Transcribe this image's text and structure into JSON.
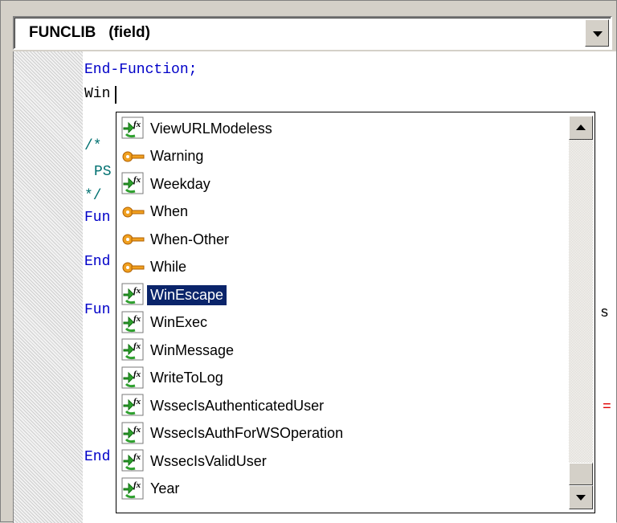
{
  "header": {
    "title": "FUNCLIB   (field)"
  },
  "editor": {
    "lines": {
      "end_function": "End-Function;",
      "typed": "Win",
      "comment_open": "/*",
      "ps": "PS",
      "comment_close": "*/",
      "fun1": "Fun",
      "end1": "End",
      "fun2": "Fun",
      "end2": "End",
      "right_as": "s",
      "right_eq": "="
    }
  },
  "autocomplete": {
    "selected": "WinEscape",
    "items": [
      {
        "label": "ViewURLModeless",
        "icon": "function-icon"
      },
      {
        "label": "Warning",
        "icon": "keyword-icon"
      },
      {
        "label": "Weekday",
        "icon": "function-icon"
      },
      {
        "label": "When",
        "icon": "keyword-icon"
      },
      {
        "label": "When-Other",
        "icon": "keyword-icon"
      },
      {
        "label": "While",
        "icon": "keyword-icon"
      },
      {
        "label": "WinEscape",
        "icon": "function-icon"
      },
      {
        "label": "WinExec",
        "icon": "function-icon"
      },
      {
        "label": "WinMessage",
        "icon": "function-icon"
      },
      {
        "label": "WriteToLog",
        "icon": "function-icon"
      },
      {
        "label": "WssecIsAuthenticatedUser",
        "icon": "function-icon"
      },
      {
        "label": "WssecIsAuthForWSOperation",
        "icon": "function-icon"
      },
      {
        "label": "WssecIsValidUser",
        "icon": "function-icon"
      },
      {
        "label": "Year",
        "icon": "function-icon"
      }
    ]
  },
  "colors": {
    "keyword": "#0000c8",
    "comment": "#007070",
    "selection": "#0a246a"
  }
}
